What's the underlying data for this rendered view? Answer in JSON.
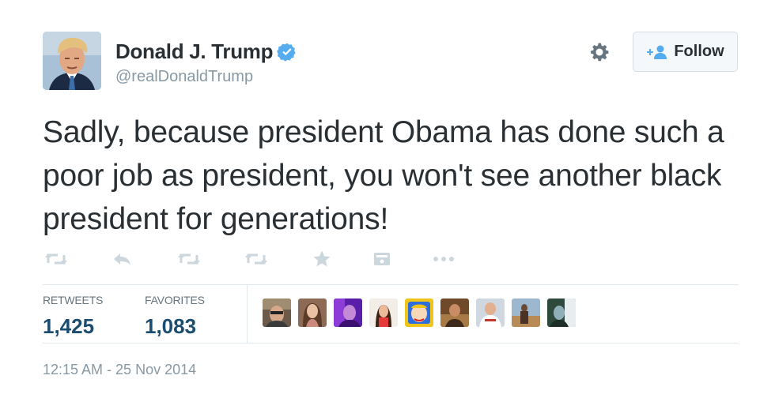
{
  "user": {
    "display_name": "Donald J. Trump",
    "screen_name": "@realDonaldTrump",
    "verified": true
  },
  "follow_button": {
    "label": "Follow",
    "icon": "add-user-icon"
  },
  "settings": {
    "icon": "gear-icon"
  },
  "tweet": {
    "text": "Sadly, because president Obama has done such a poor job as president, you won't see another black president for generations!"
  },
  "actions": [
    {
      "name": "retweet-icon"
    },
    {
      "name": "reply-icon"
    },
    {
      "name": "retweet-icon"
    },
    {
      "name": "retweet-icon"
    },
    {
      "name": "favorite-star-icon"
    },
    {
      "name": "embed-icon"
    },
    {
      "name": "more-icon"
    }
  ],
  "stats": {
    "retweets_label": "RETWEETS",
    "retweets_value": "1,425",
    "favorites_label": "FAVORITES",
    "favorites_value": "1,083"
  },
  "favoriters_count_shown": 9,
  "timestamp": "12:15 AM - 25 Nov 2014",
  "colors": {
    "text": "#292f33",
    "muted": "#8899a6",
    "icon": "#ccd6dd",
    "verified": "#55acee",
    "stat_value": "#1b4d70",
    "divider": "#e1e8ed"
  }
}
